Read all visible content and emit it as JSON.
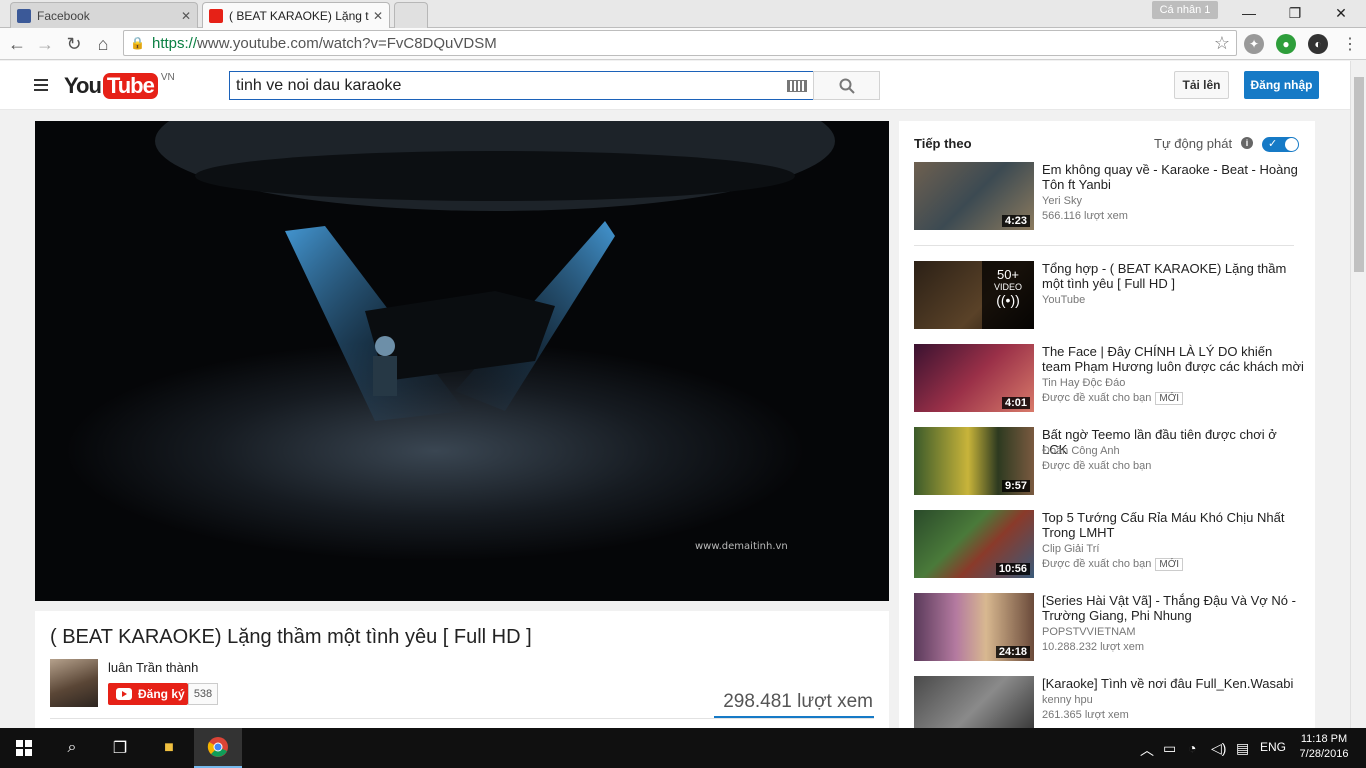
{
  "browser": {
    "tabs": [
      {
        "label": "Facebook",
        "active": false
      },
      {
        "label": "( BEAT KARAOKE) Lặng thầ",
        "active": true
      }
    ],
    "profile": "Cá nhân 1",
    "url_scheme": "https://",
    "url_rest": "www.youtube.com/watch?v=FvC8DQuVDSM"
  },
  "youtube": {
    "logo_you": "You",
    "logo_tube": "Tube",
    "logo_region": "VN",
    "search_query": "tinh ve noi dau karaoke",
    "upload_label": "Tải lên",
    "signin_label": "Đăng nhập"
  },
  "player": {
    "watermark": "www.demaitinh.vn"
  },
  "video": {
    "title": "( BEAT KARAOKE) Lặng thầm một tình yêu [ Full HD ]",
    "channel": "luân Trần thành",
    "subscribe_label": "Đăng ký",
    "subscriber_count": "538",
    "views": "298.481 lượt xem"
  },
  "sidebar": {
    "next_label": "Tiếp theo",
    "autoplay_label": "Tự động phát",
    "autoplay_on": true,
    "items": [
      {
        "title": "Em không quay về - Karaoke - Beat - Hoàng Tôn ft Yanbi",
        "channel": "Yeri Sky",
        "meta": "566.116 lượt xem",
        "duration": "4:23",
        "badge": ""
      },
      {
        "title": "Tổng hợp - ( BEAT KARAOKE) Lặng thầm một tình yêu [ Full HD ]",
        "channel": "YouTube",
        "meta": "",
        "duration": "",
        "playlist_count": "50+",
        "playlist_label": "VIDEO",
        "badge": ""
      },
      {
        "title": "The Face | Đây CHÍNH LÀ LÝ DO khiến team Phạm Hương luôn được các khách mời bình",
        "channel": "Tin Hay Độc Đáo",
        "meta": "Được đề xuất cho bạn",
        "duration": "4:01",
        "badge": "MỚI"
      },
      {
        "title": "Bất ngờ Teemo lần đầu tiên được chơi ở LCK",
        "channel": "Đoàn Công Anh",
        "meta": "Được đề xuất cho bạn",
        "duration": "9:57",
        "badge": ""
      },
      {
        "title": "Top 5 Tướng Cấu Rỉa Máu Khó Chịu Nhất Trong LMHT",
        "channel": "Clip Giải Trí",
        "meta": "Được đề xuất cho bạn",
        "duration": "10:56",
        "badge": "MỚI"
      },
      {
        "title": "[Series Hài Vật Vã] - Thắng Đậu Và Vợ Nó - Trường Giang, Phi Nhung",
        "channel": "POPSTVVIETNAM",
        "meta": "10.288.232 lượt xem",
        "duration": "24:18",
        "badge": ""
      },
      {
        "title": "[Karaoke] Tình về nơi đâu Full_Ken.Wasabi",
        "channel": "kenny hpu",
        "meta": "261.365 lượt xem",
        "duration": "",
        "badge": ""
      }
    ]
  },
  "taskbar": {
    "language": "ENG",
    "time": "11:18 PM",
    "date": "7/28/2016"
  },
  "colors": {
    "youtube_red": "#e62117",
    "youtube_blue": "#167ac6"
  }
}
